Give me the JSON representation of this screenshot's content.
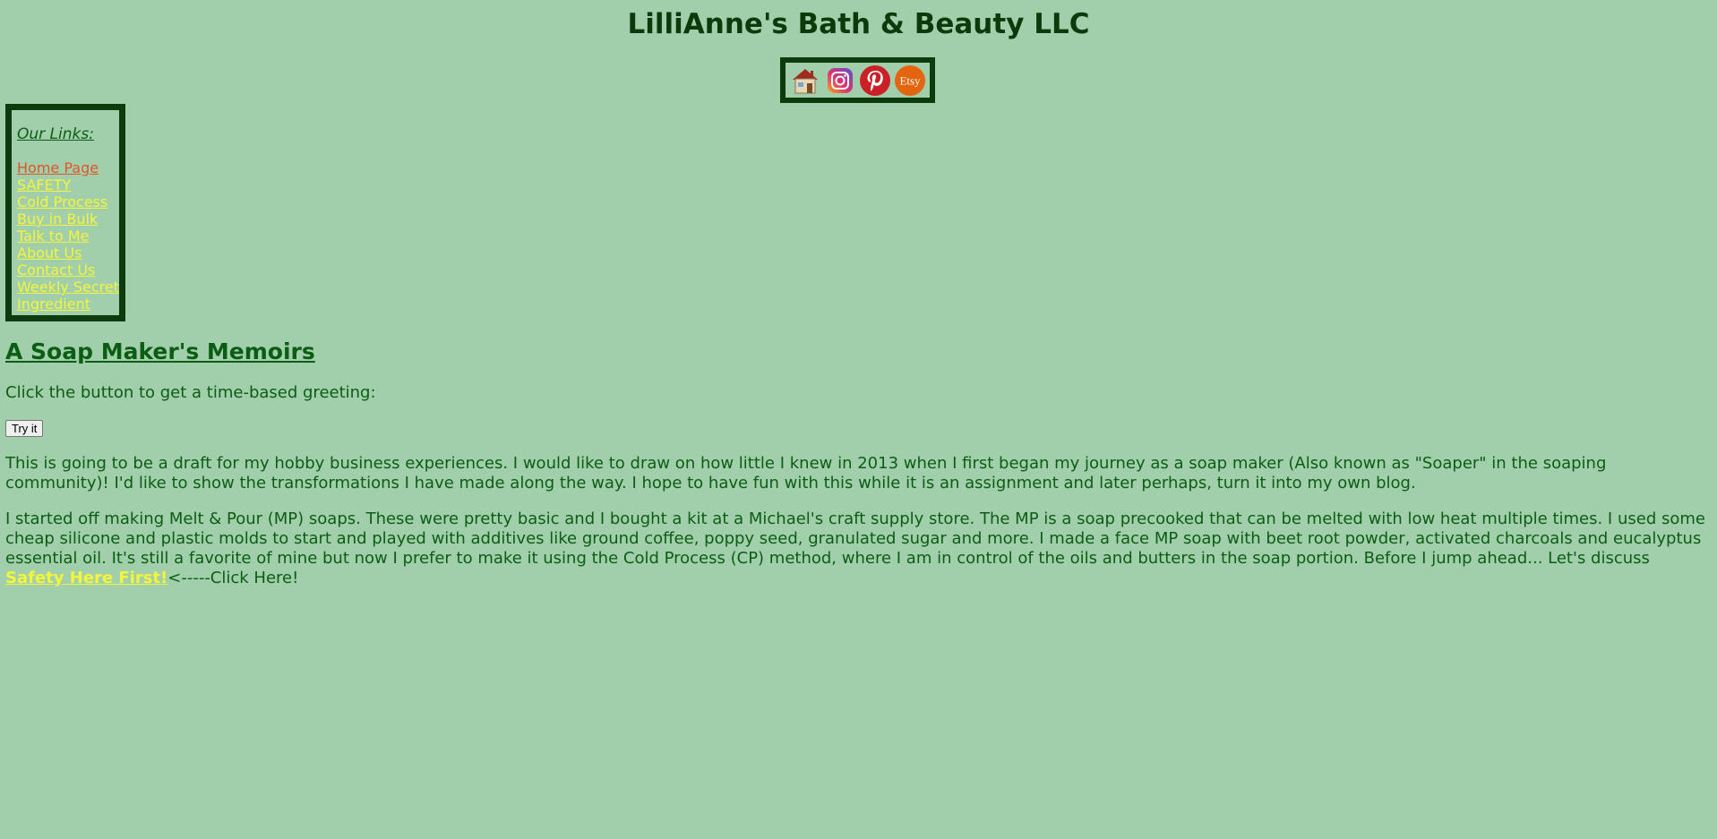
{
  "site": {
    "title": "LilliAnne's Bath & Beauty LLC"
  },
  "social": {
    "icons": [
      "home-icon",
      "instagram-icon",
      "pinterest-icon",
      "etsy-icon"
    ],
    "etsy_label": "Etsy",
    "colors": {
      "instagram": "#c13584",
      "pinterest": "#cb2027",
      "etsy": "#e4650f",
      "home_roof": "#a32a1e"
    }
  },
  "sidebar": {
    "heading": "Our Links:",
    "items": [
      {
        "label": "Home Page"
      },
      {
        "label": "SAFETY"
      },
      {
        "label": "Cold Process"
      },
      {
        "label": "Buy in Bulk"
      },
      {
        "label": "Talk to Me"
      },
      {
        "label": "About Us"
      },
      {
        "label": "Contact Us"
      },
      {
        "label": "Weekly Secret Ingredient"
      }
    ]
  },
  "main": {
    "heading": "A Soap Maker's Memoirs",
    "greeting_prompt": "Click the button to get a time-based greeting:",
    "try_button": "Try it",
    "paragraph1": "This is going to be a draft for my hobby business experiences. I would like to draw on how little I knew in 2013 when I first began my journey as a soap maker (Also known as \"Soaper\" in the soaping community)! I'd like to show the transformations I have made along the way. I hope to have fun with this while it is an assignment and later perhaps, turn it into my own blog.",
    "paragraph2": "I started off making Melt & Pour (MP) soaps. These were pretty basic and I bought a kit at a Michael's craft supply store. The MP is a soap precooked that can be melted with low heat multiple times. I used some cheap silicone and plastic molds to start and played with additives like ground coffee, poppy seed, granulated sugar and more. I made a face MP soap with beet root powder, activated charcoals and eucalyptus essential oil. It's still a favorite of mine but now I prefer to make it using the Cold Process (CP) method, where I am in control of the oils and butters in the soap portion. Before I jump ahead... Let's discuss ",
    "safety_link": "Safety Here First!",
    "click_here": "<-----Click Here!"
  },
  "colors": {
    "background": "#a2cfab",
    "text": "#0b5d14",
    "link": "#f5f53a",
    "visited_link": "#e0542a",
    "border": "#0d3b0d"
  }
}
